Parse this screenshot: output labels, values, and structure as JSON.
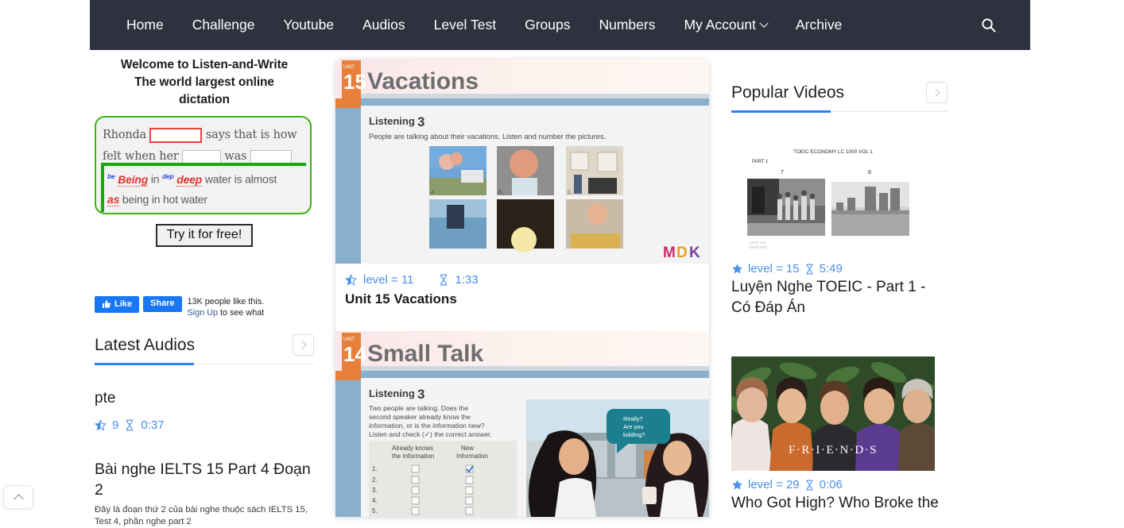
{
  "nav": {
    "items": [
      {
        "label": "Home",
        "name": "nav-home",
        "caret": false
      },
      {
        "label": "Challenge",
        "name": "nav-challenge",
        "caret": false
      },
      {
        "label": "Youtube",
        "name": "nav-youtube",
        "caret": false
      },
      {
        "label": "Audios",
        "name": "nav-audios",
        "caret": false
      },
      {
        "label": "Level Test",
        "name": "nav-level-test",
        "caret": false
      },
      {
        "label": "Groups",
        "name": "nav-groups",
        "caret": false
      },
      {
        "label": "Numbers",
        "name": "nav-numbers",
        "caret": false
      },
      {
        "label": "My Account",
        "name": "nav-my-account",
        "caret": true
      },
      {
        "label": "Archive",
        "name": "nav-archive",
        "caret": false
      }
    ],
    "search_icon": "search-icon",
    "background": "#2e323f"
  },
  "promo": {
    "heading_line1": "Welcome to Listen-and-Write",
    "heading_line2": "The world largest online",
    "heading_line3": "dictation",
    "demo": {
      "line1_before": "Rhonda",
      "line1_after": "says that is how",
      "line2_a": "felt when her",
      "line2_b": "was",
      "answer_sup1": "be",
      "answer_word1": "Being",
      "answer_mid1": "in",
      "answer_sup2": "dep",
      "answer_word2": "deep",
      "answer_tail1": "water is almost",
      "answer_word3": "as",
      "answer_tail2": "being in hot water",
      "border_color": "#3db317",
      "blank_highlight_color": "#e8433a"
    },
    "try_button": "Try it for free!"
  },
  "facebook": {
    "like_label": "Like",
    "share_label": "Share",
    "count_text": "13K people like this.",
    "signup_label": "Sign Up",
    "signup_tail": "to see what",
    "brand_color": "#1877f2"
  },
  "latest_audios": {
    "title": "Latest Audios",
    "next_icon": "chevron-right-icon",
    "items": [
      {
        "title": "pte",
        "level": "9",
        "duration": "0:37",
        "description": ""
      },
      {
        "title": "Bài nghe IELTS 15 Part 4 Đoạn 2",
        "level": "",
        "duration": "",
        "description": "Đây là đoạn thứ 2 của bài nghe thuộc sách IELTS 15, Test 4, phần nghe part 2"
      }
    ]
  },
  "center_cards": [
    {
      "unit_number": "15",
      "unit_name": "Vacations",
      "listening_label": "Listening",
      "listening_number": "3",
      "instruction": "People are talking about their vacations. Listen and number the pictures.",
      "watermark": "MDK",
      "level": "level = 11",
      "duration": "1:33",
      "title": "Unit 15 Vacations"
    },
    {
      "unit_number": "14",
      "unit_name": "Small Talk",
      "listening_label": "Listening",
      "listening_number": "3",
      "instruction": "Two people are talking. Does the second speaker already know the information, or is the information new? Listen and check (✓) the correct answer.",
      "col1": "Already knows the Information",
      "col2": "New Information",
      "rows": [
        "1.",
        "2.",
        "3.",
        "4.",
        "5."
      ],
      "bubble": "Really? Are you kidding?",
      "level": "",
      "duration": "",
      "title": ""
    }
  ],
  "popular_videos": {
    "title": "Popular Videos",
    "next_icon": "chevron-right-icon",
    "items": [
      {
        "level": "level = 15",
        "duration": "5:49",
        "title": "Luyện Nghe TOEIC - Part 1 - Có Đáp Án",
        "thumb_caption": "TOEIC ECONOMY LC 1000 VOL 1",
        "thumb_part": "PART 1",
        "thumb_num1": "7",
        "thumb_num2": "8"
      },
      {
        "level": "level = 29",
        "duration": "0:06",
        "title": "Who Got High? Who Broke the",
        "thumb_caption": "F·R·I·E·N·D·S"
      }
    ]
  },
  "scroll_top": {
    "icon": "chevron-up-icon"
  },
  "accent_color": "#2d7ff9",
  "link_color": "#4a90e8"
}
